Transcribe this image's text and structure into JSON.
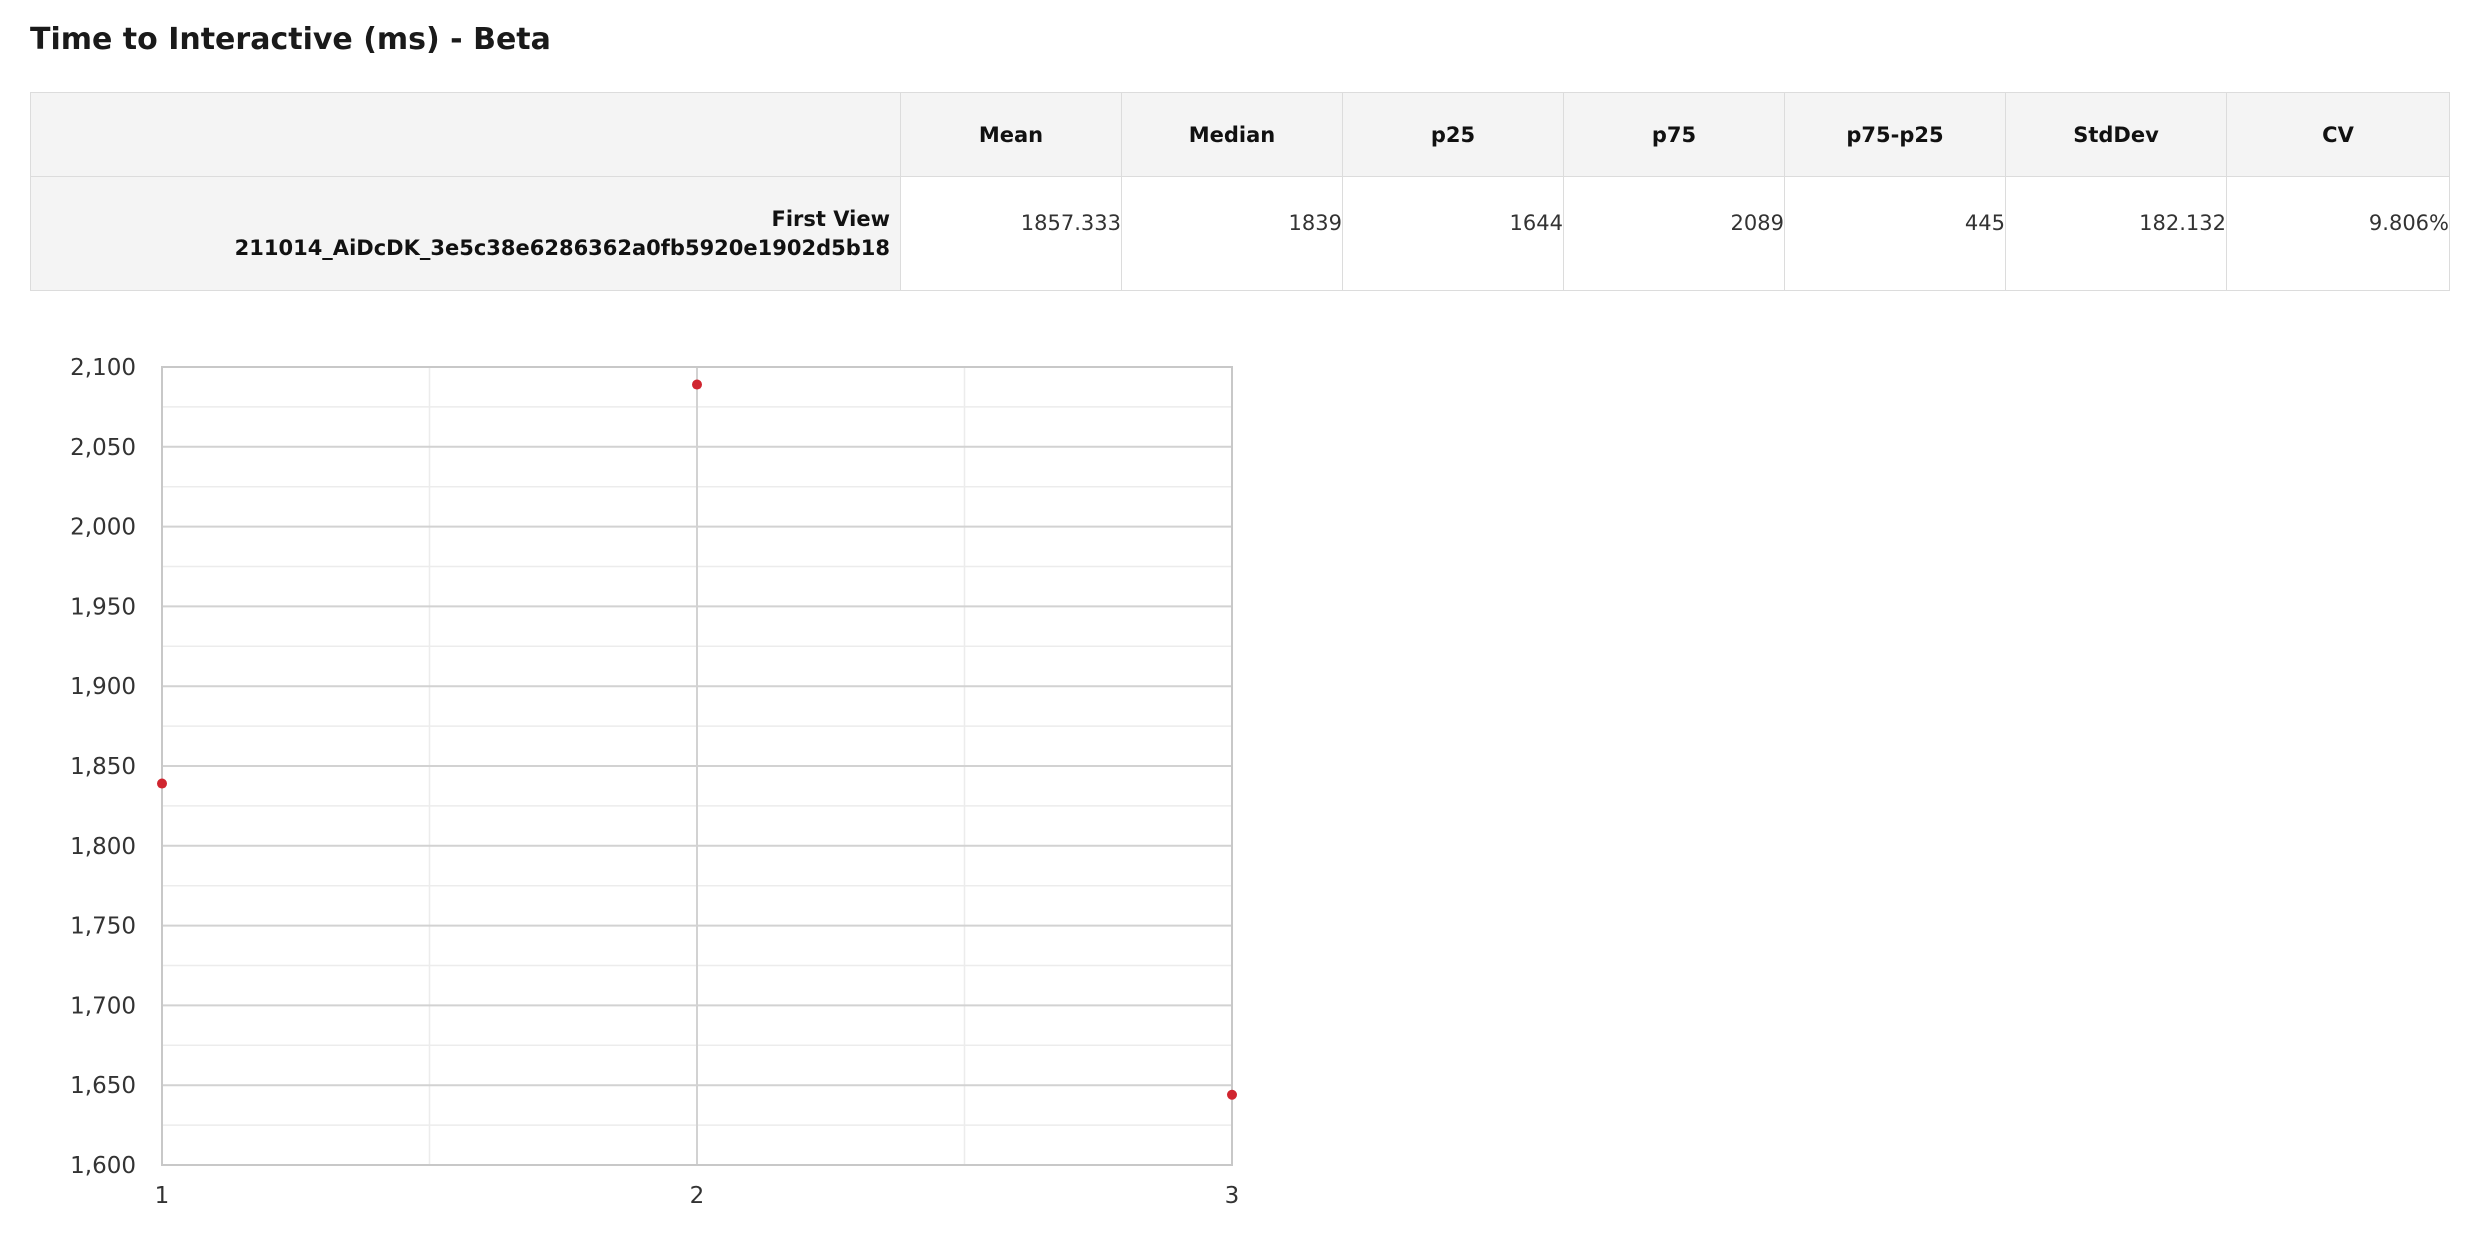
{
  "title": "Time to Interactive (ms) - Beta",
  "table": {
    "columns": [
      "Mean",
      "Median",
      "p25",
      "p75",
      "p75-p25",
      "StdDev",
      "CV"
    ],
    "rows": [
      {
        "label_line1": "First View",
        "label_line2": "211014_AiDcDK_3e5c38e6286362a0fb5920e1902d5b18",
        "values": [
          "1857.333",
          "1839",
          "1644",
          "2089",
          "445",
          "182.132",
          "9.806%"
        ]
      }
    ]
  },
  "chart_data": {
    "type": "scatter",
    "x": [
      1,
      2,
      3
    ],
    "y": [
      1839,
      2089,
      1644
    ],
    "xlim": [
      1,
      3
    ],
    "ylim": [
      1600,
      2100
    ],
    "xticks": [
      "1",
      "2",
      "3"
    ],
    "yticks": [
      "1,600",
      "1,650",
      "1,700",
      "1,750",
      "1,800",
      "1,850",
      "1,900",
      "1,950",
      "2,000",
      "2,050",
      "2,100"
    ],
    "grid": true,
    "point_color": "#d0252f"
  }
}
